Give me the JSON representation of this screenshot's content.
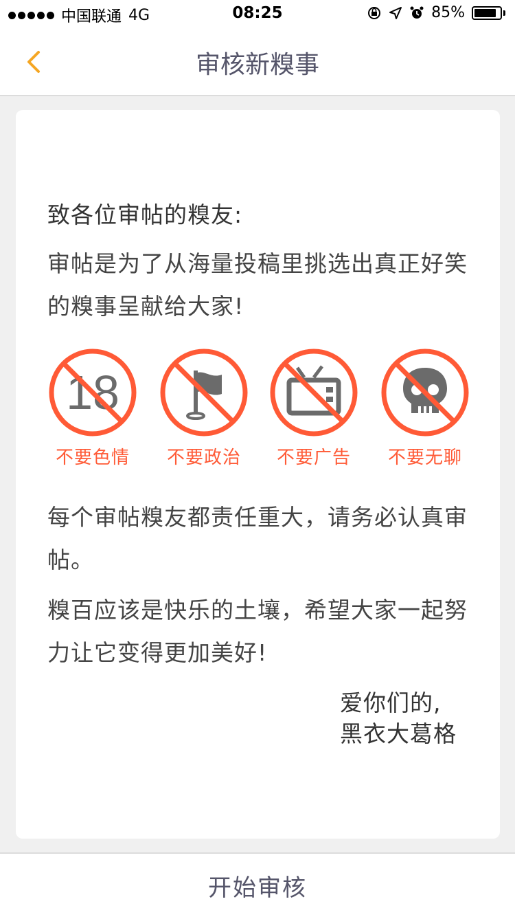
{
  "status_bar": {
    "carrier": "中国联通",
    "network": "4G",
    "time": "08:25",
    "battery_percent_label": "85%",
    "battery_level": 0.85
  },
  "nav": {
    "title": "审核新糗事",
    "back_icon": "chevron-left-icon",
    "accent_color": "#f5a623"
  },
  "card": {
    "greeting": "致各位审帖的糗友:",
    "intro": "审帖是为了从海量投稿里挑选出真正好笑的糗事呈献给大家!",
    "rules": [
      {
        "icon": "no-18-icon",
        "label": "不要色情"
      },
      {
        "icon": "no-politics-flag-icon",
        "label": "不要政治"
      },
      {
        "icon": "no-ad-tv-icon",
        "label": "不要广告"
      },
      {
        "icon": "no-boring-skull-icon",
        "label": "不要无聊"
      }
    ],
    "rule_color": "#ff5a36",
    "paragraph_responsibility": "每个审帖糗友都责任重大，请务必认真审帖。",
    "paragraph_hope": "糗百应该是快乐的土壤，希望大家一起努力让它变得更加美好!",
    "signature_line1": "爱你们的,",
    "signature_line2": "黑衣大葛格"
  },
  "bottom": {
    "start_label": "开始审核"
  }
}
